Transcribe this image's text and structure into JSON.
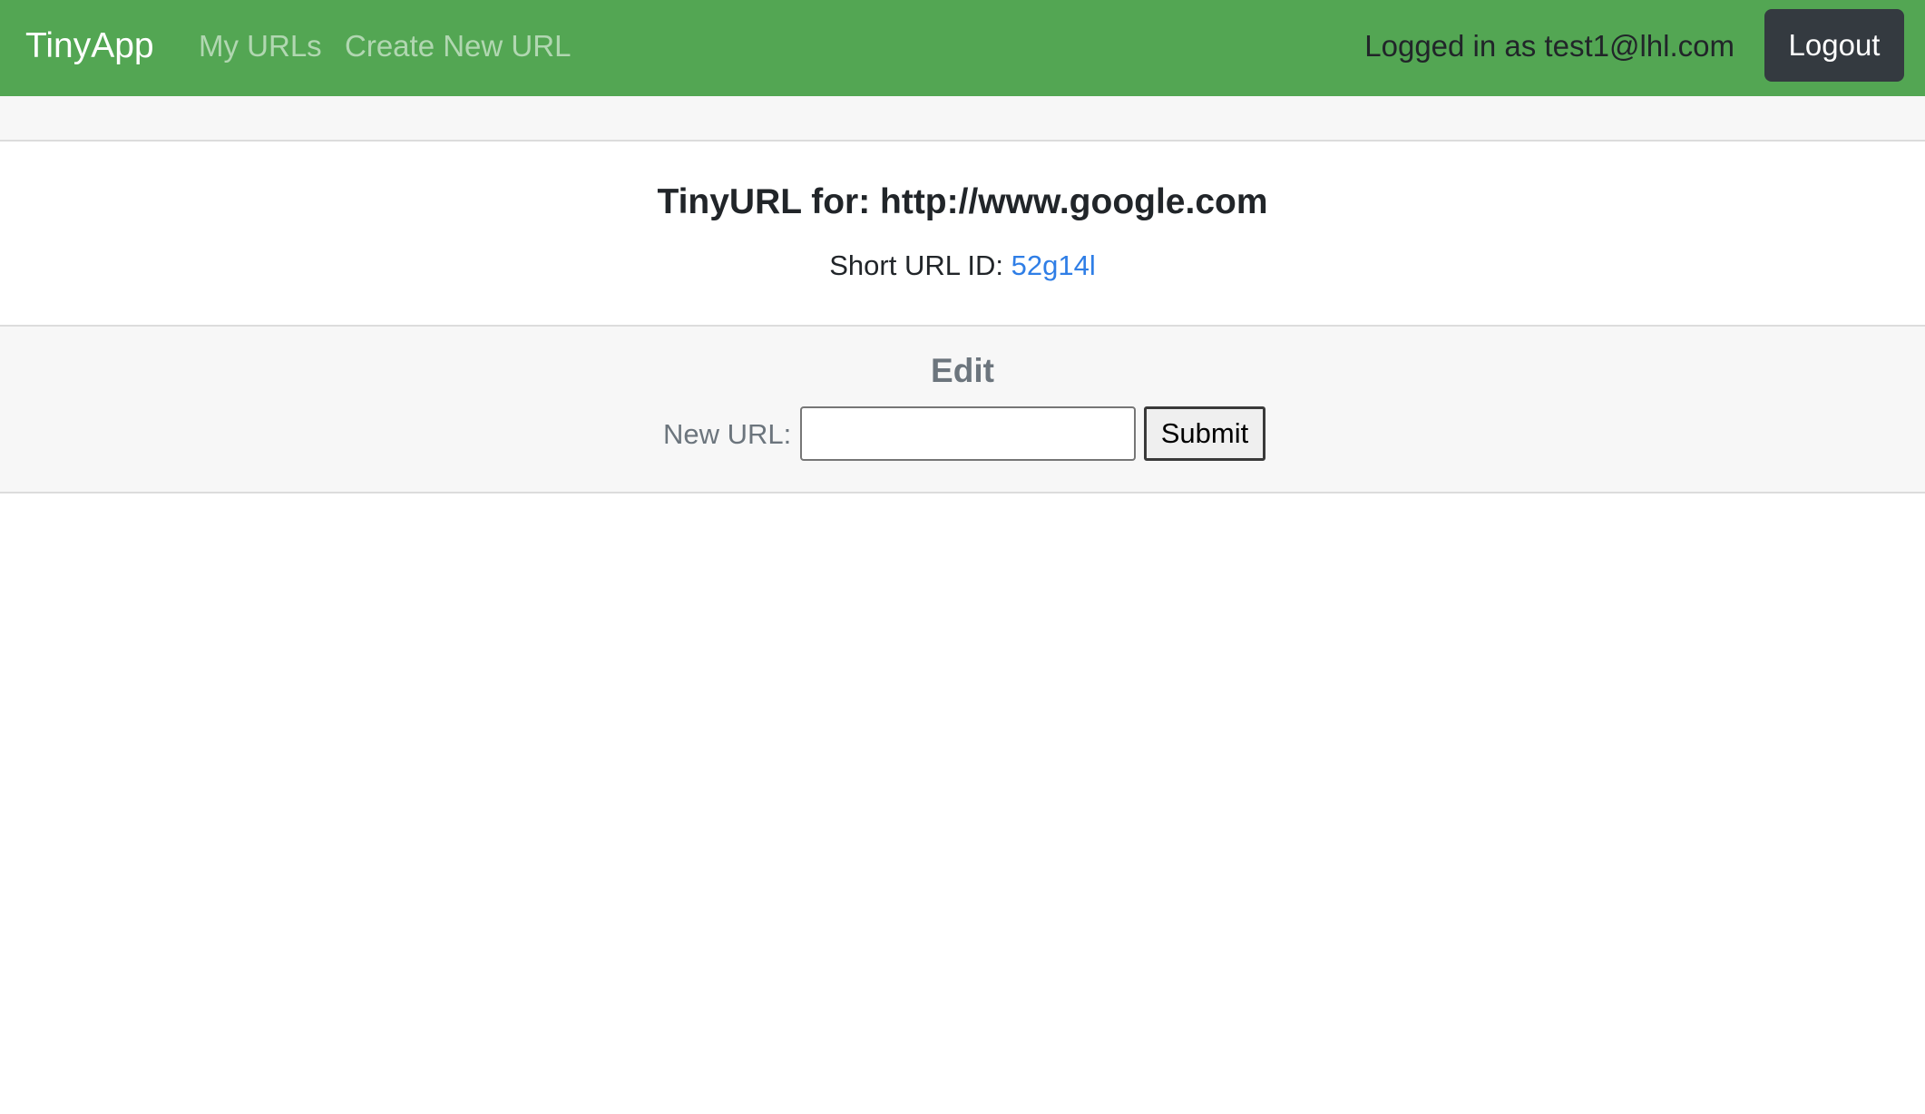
{
  "navbar": {
    "brand": "TinyApp",
    "links": [
      {
        "label": "My URLs"
      },
      {
        "label": "Create New URL"
      }
    ],
    "logged_in_text": "Logged in as test1@lhl.com",
    "logout_label": "Logout",
    "bg_color": "#53a653"
  },
  "main": {
    "title": "TinyURL for: http://www.google.com",
    "short_url_label": "Short URL ID:",
    "short_url_id": "52g14l",
    "link_color": "#2f7ee6"
  },
  "edit": {
    "title": "Edit",
    "new_url_label": "New URL:",
    "new_url_value": "",
    "new_url_placeholder": "",
    "submit_label": "Submit"
  }
}
